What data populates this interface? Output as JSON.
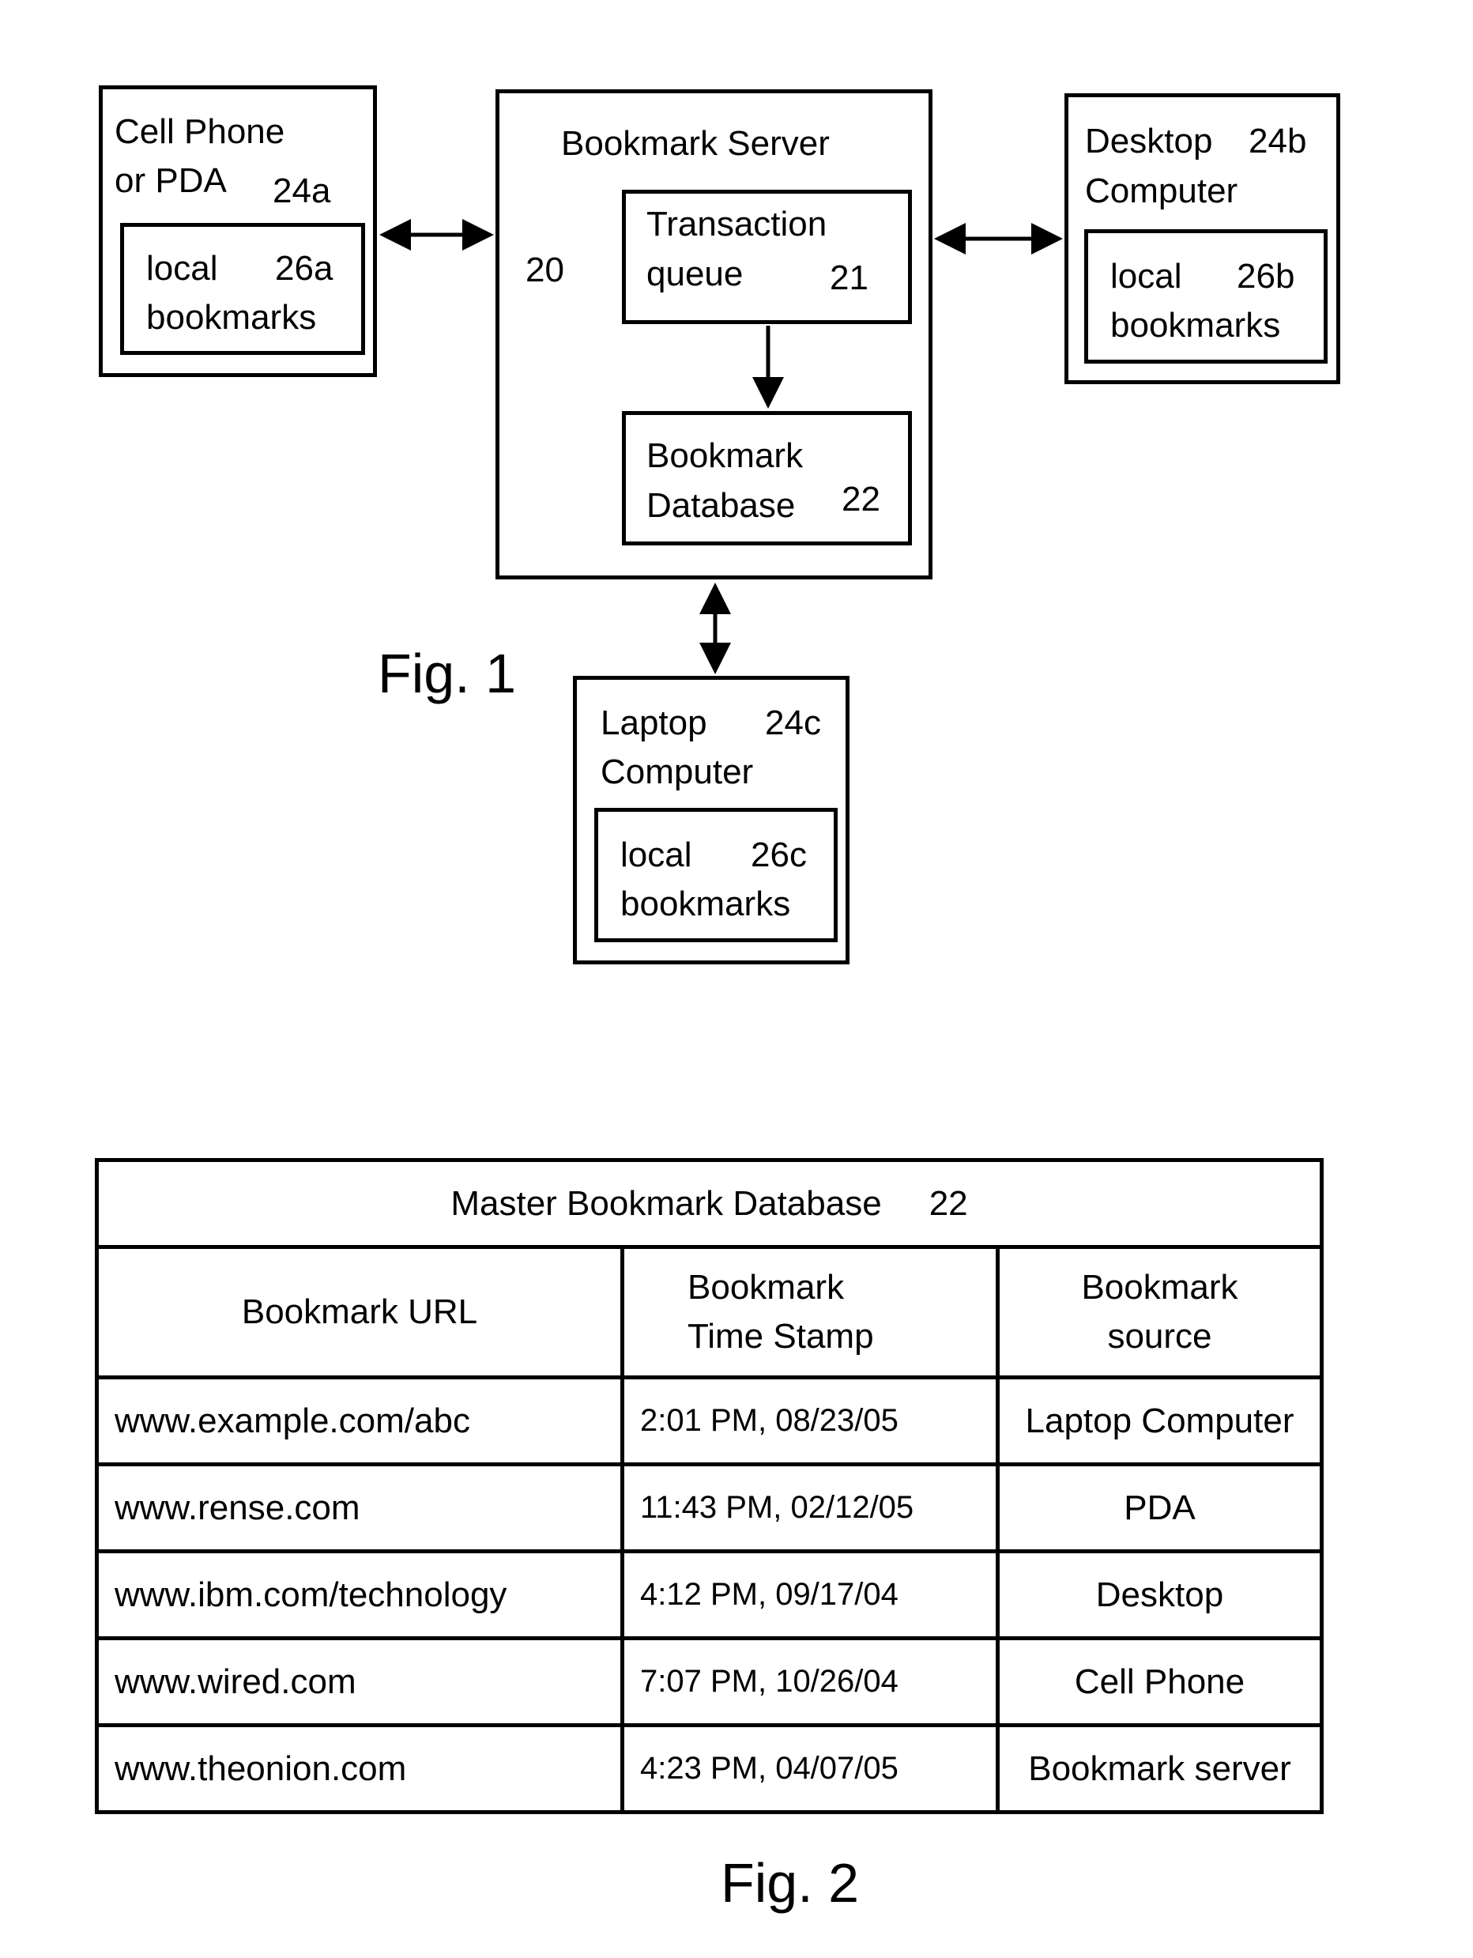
{
  "figure1": {
    "caption": "Fig. 1",
    "cell_phone": {
      "line1": "Cell Phone",
      "line2": "or PDA",
      "ref": "24a",
      "local": {
        "line1": "local",
        "ref": "26a",
        "line2": "bookmarks"
      }
    },
    "server": {
      "title": "Bookmark Server",
      "ref": "20",
      "queue": {
        "line1": "Transaction",
        "line2": "queue",
        "ref": "21"
      },
      "database": {
        "line1": "Bookmark",
        "line2": "Database",
        "ref": "22"
      }
    },
    "desktop": {
      "line1": "Desktop",
      "ref": "24b",
      "line2": "Computer",
      "local": {
        "line1": "local",
        "ref": "26b",
        "line2": "bookmarks"
      }
    },
    "laptop": {
      "line1": "Laptop",
      "ref": "24c",
      "line2": "Computer",
      "local": {
        "line1": "local",
        "ref": "26c",
        "line2": "bookmarks"
      }
    }
  },
  "figure2": {
    "caption": "Fig. 2",
    "title": "Master Bookmark Database",
    "title_ref": "22",
    "headers": {
      "url": "Bookmark URL",
      "ts_line1": "Bookmark",
      "ts_line2": "Time Stamp",
      "src_line1": "Bookmark",
      "src_line2": "source"
    },
    "rows": [
      {
        "url": "www.example.com/abc",
        "timestamp": "2:01 PM, 08/23/05",
        "source": "Laptop Computer"
      },
      {
        "url": "www.rense.com",
        "timestamp": "11:43 PM, 02/12/05",
        "source": "PDA"
      },
      {
        "url": "www.ibm.com/technology",
        "timestamp": "4:12 PM, 09/17/04",
        "source": "Desktop"
      },
      {
        "url": "www.wired.com",
        "timestamp": "7:07 PM, 10/26/04",
        "source": "Cell Phone"
      },
      {
        "url": "www.theonion.com",
        "timestamp": "4:23 PM, 04/07/05",
        "source": "Bookmark server"
      }
    ]
  }
}
